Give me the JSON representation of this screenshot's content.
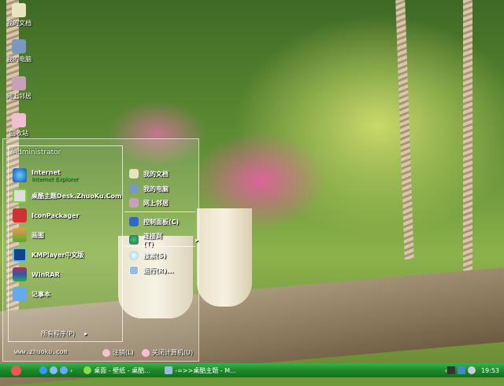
{
  "desktop": {
    "icons": [
      {
        "label": "我的文档",
        "icon": "my-documents-icon"
      },
      {
        "label": "我的电脑",
        "icon": "my-computer-icon"
      },
      {
        "label": "网上邻居",
        "icon": "network-icon"
      },
      {
        "label": "回收站",
        "icon": "recycle-bin-icon"
      }
    ]
  },
  "start_menu": {
    "user": "Administrator",
    "programs": [
      {
        "label": "Internet",
        "sub": "Internet Explorer",
        "icon": "ie-icon"
      },
      {
        "label": "桌酷主题Desk.ZhuoKu.Com",
        "icon": "zhuoku-icon"
      },
      {
        "label": "IconPackager",
        "icon": "iconpackager-icon"
      },
      {
        "label": "画图",
        "icon": "paint-icon"
      },
      {
        "label": "KMPlayer中文版",
        "icon": "kmplayer-icon"
      },
      {
        "label": "WinRAR",
        "icon": "winrar-icon"
      },
      {
        "label": "记事本",
        "icon": "notepad-icon"
      }
    ],
    "all_programs": "所有程序(P)",
    "places": [
      {
        "label": "我的文档",
        "icon": "my-documents-icon"
      },
      {
        "label": "我的电脑",
        "icon": "my-computer-icon"
      },
      {
        "label": "网上邻居",
        "icon": "network-icon"
      }
    ],
    "system": [
      {
        "label": "控制面板(C)",
        "icon": "control-panel-icon"
      },
      {
        "label": "连接到(T)",
        "icon": "connect-icon"
      }
    ],
    "tools": [
      {
        "label": "搜索(S)",
        "icon": "search-icon"
      },
      {
        "label": "运行(R)...",
        "icon": "run-icon"
      }
    ],
    "website": "www.zhuoku.com",
    "logoff": "注销(L)",
    "shutdown": "关闭计算机(U)"
  },
  "taskbar": {
    "tasks": [
      "桌面 - 壁纸 - 桌酷...",
      "-=>>桌酷主题 - M..."
    ],
    "clock": "19:53"
  }
}
